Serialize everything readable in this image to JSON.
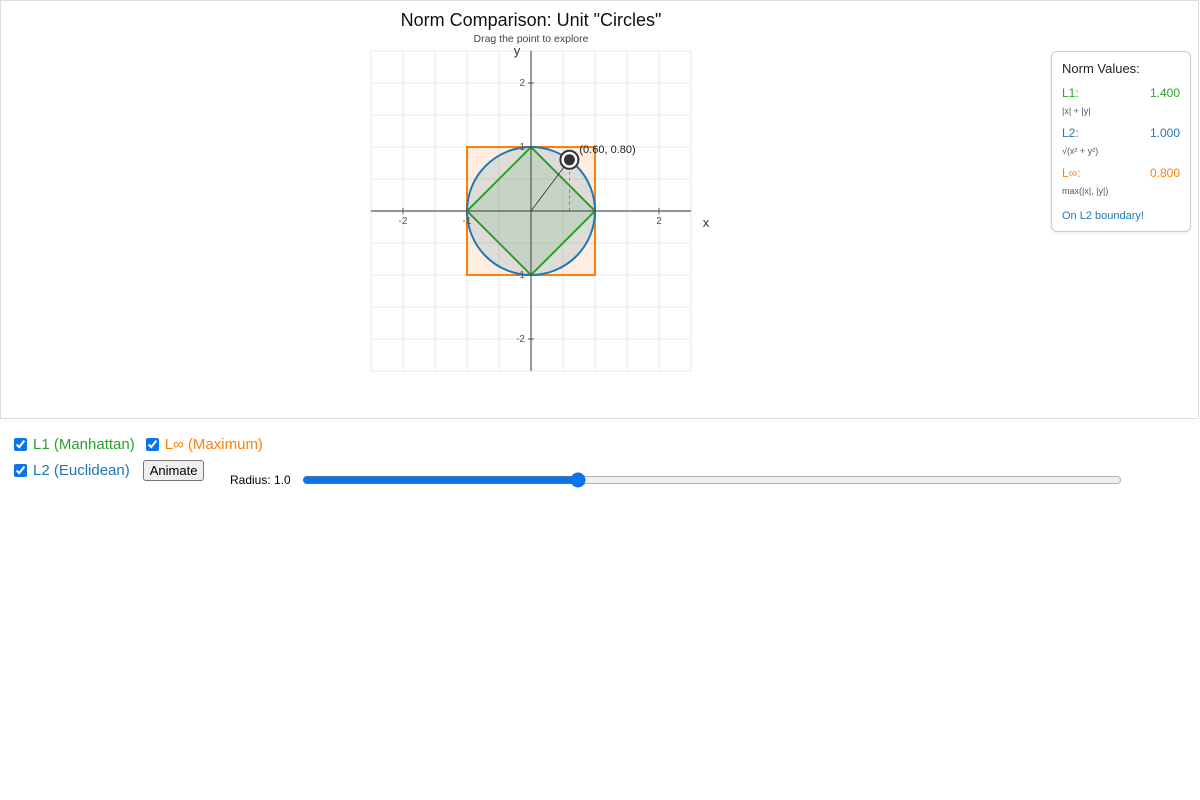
{
  "plot": {
    "title": "Norm Comparison: Unit \"Circles\"",
    "subtitle": "Drag the point to explore",
    "x_axis_label": "x",
    "y_axis_label": "y",
    "x_tick_labels": [
      "-2",
      "-1",
      "2"
    ],
    "y_tick_labels": [
      "2",
      "1",
      "-1",
      "-2"
    ],
    "point_label": "(0.60, 0.80)",
    "x_range": [
      -2.5,
      2.5
    ],
    "y_range": [
      -2.5,
      2.5
    ],
    "grid_step": 0.5,
    "grid": true,
    "point": {
      "x": 0.6,
      "y": 0.8
    },
    "radius": 1.0
  },
  "chart_data": {
    "type": "scatter",
    "title": "Norm Comparison: Unit \"Circles\"",
    "subtitle": "Drag the point to explore",
    "xlabel": "x",
    "ylabel": "y",
    "xlim": [
      -2.5,
      2.5
    ],
    "ylim": [
      -2.5,
      2.5
    ],
    "grid": true,
    "series": [
      {
        "name": "L1 (Manhattan)",
        "values": [
          [
            1,
            0
          ],
          [
            0,
            1
          ],
          [
            -1,
            0
          ],
          [
            0,
            -1
          ]
        ]
      },
      {
        "name": "L2 (Euclidean)",
        "values": [
          [
            1,
            0
          ],
          [
            0,
            1
          ],
          [
            -1,
            0
          ],
          [
            0,
            -1
          ]
        ]
      },
      {
        "name": "L∞ (Maximum)",
        "values": [
          [
            1,
            1
          ],
          [
            -1,
            1
          ],
          [
            -1,
            -1
          ],
          [
            1,
            -1
          ]
        ]
      }
    ],
    "points": [
      {
        "x": 0.6,
        "y": 0.8,
        "label": "(0.60, 0.80)"
      }
    ]
  },
  "norm_panel": {
    "title": "Norm Values:",
    "l1": {
      "label": "L1:",
      "value": "1.400",
      "formula": "|x| + |y|"
    },
    "l2": {
      "label": "L2:",
      "value": "1.000",
      "formula": "√(x² + y²)"
    },
    "linf": {
      "label": "L∞:",
      "value": "0.800",
      "formula": "max(|x|, |y|)"
    },
    "status": "On L2 boundary!"
  },
  "controls": {
    "l1_checkbox_label": "L1 (Manhattan)",
    "linf_checkbox_label": "L∞ (Maximum)",
    "l2_checkbox_label": "L2 (Euclidean)",
    "l1_checked": true,
    "linf_checked": true,
    "l2_checked": true,
    "animate_label": "Animate",
    "radius_label": "Radius: 1.0",
    "radius_min": 0,
    "radius_max": 3,
    "radius_value": 1.0
  },
  "colors": {
    "l1": "#2ca02c",
    "l2": "#1f77b4",
    "linf": "#ff7f0e",
    "l1_fill": "#2ca02c",
    "l2_fill": "#1f77b4",
    "linf_fill": "#ff7f0e",
    "axis": "#555555",
    "grid": "#e8e8e8",
    "status": "#1f77b4"
  }
}
